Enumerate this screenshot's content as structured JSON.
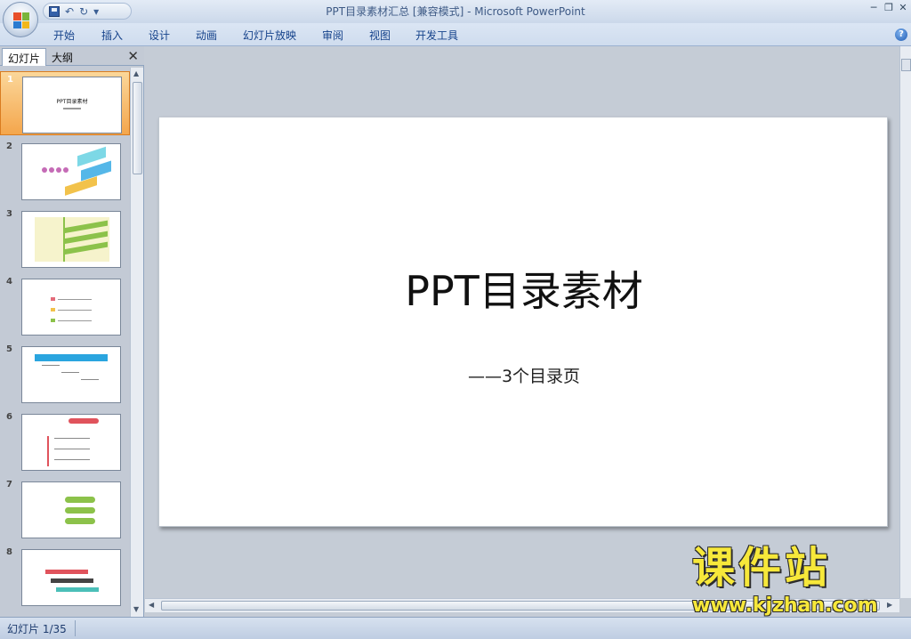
{
  "window": {
    "doc_title": "PPT目录素材汇总 [兼容模式]",
    "separator": " - ",
    "app_name": "Microsoft PowerPoint",
    "minimize": "─",
    "restore": "❐",
    "close": "✕"
  },
  "quick_access": {
    "save_icon": "save-icon",
    "undo": "↶",
    "redo": "↻",
    "more": "▾"
  },
  "ribbon": {
    "tabs": [
      "开始",
      "插入",
      "设计",
      "动画",
      "幻灯片放映",
      "审阅",
      "视图",
      "开发工具"
    ],
    "help": "?"
  },
  "left_panel": {
    "tab_slides": "幻灯片",
    "tab_outline": "大纲",
    "close": "✕",
    "slide_numbers": [
      "1",
      "2",
      "3",
      "4",
      "5",
      "6",
      "7",
      "8"
    ],
    "thumb1_title": "PPT目录素材"
  },
  "slide": {
    "title": "PPT目录素材",
    "subtitle": "——3个目录页"
  },
  "status": {
    "slide_indicator": "幻灯片 1/35"
  },
  "watermark": {
    "main": "课件站",
    "url": "www.kjzhan.com"
  },
  "colors": {
    "selection": "#f4a64c",
    "ribbon_text": "#15428b",
    "watermark": "#f7e83a"
  }
}
